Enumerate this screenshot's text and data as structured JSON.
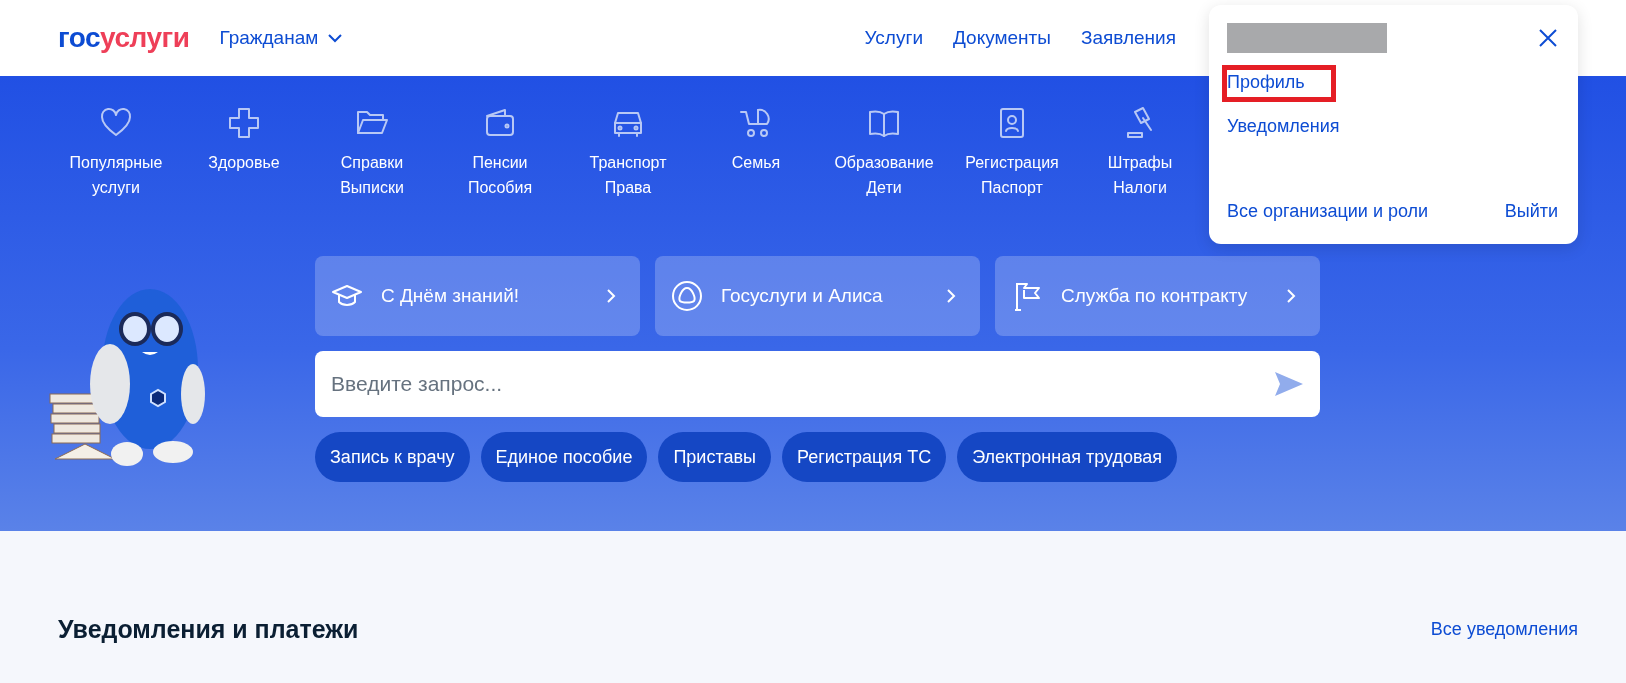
{
  "header": {
    "logo": {
      "part_1": "гос",
      "part_2": "услуги"
    },
    "audience_menu": "Гражданам",
    "nav": [
      "Услуги",
      "Документы",
      "Заявления"
    ]
  },
  "categories": [
    {
      "line_1": "Популярные",
      "line_2": "услуги"
    },
    {
      "line_1": "Здоровье"
    },
    {
      "line_1": "Справки",
      "line_2": "Выписки"
    },
    {
      "line_1": "Пенсии",
      "line_2": "Пособия"
    },
    {
      "line_1": "Транспорт",
      "line_2": "Права"
    },
    {
      "line_1": "Семья"
    },
    {
      "line_1": "Образование",
      "line_2": "Дети"
    },
    {
      "line_1": "Регистрация",
      "line_2": "Паспорт"
    },
    {
      "line_1": "Штрафы",
      "line_2": "Налоги"
    }
  ],
  "promo_cards": [
    "С Днём знаний!",
    "Госуслуги и Алиса",
    "Служба по контракту"
  ],
  "search": {
    "placeholder": "Введите запрос..."
  },
  "quick_links": [
    "Запись к врачу",
    "Единое пособие",
    "Приставы",
    "Регистрация ТС",
    "Электронная трудовая"
  ],
  "notifications": {
    "title": "Уведомления и платежи",
    "all_link": "Все уведомления"
  },
  "profile_menu": {
    "items": [
      {
        "label": "Профиль",
        "highlighted": true
      },
      {
        "label": "Уведомления",
        "highlighted": false
      }
    ],
    "organizations_link": "Все организации и роли",
    "logout_link": "Выйти"
  }
}
